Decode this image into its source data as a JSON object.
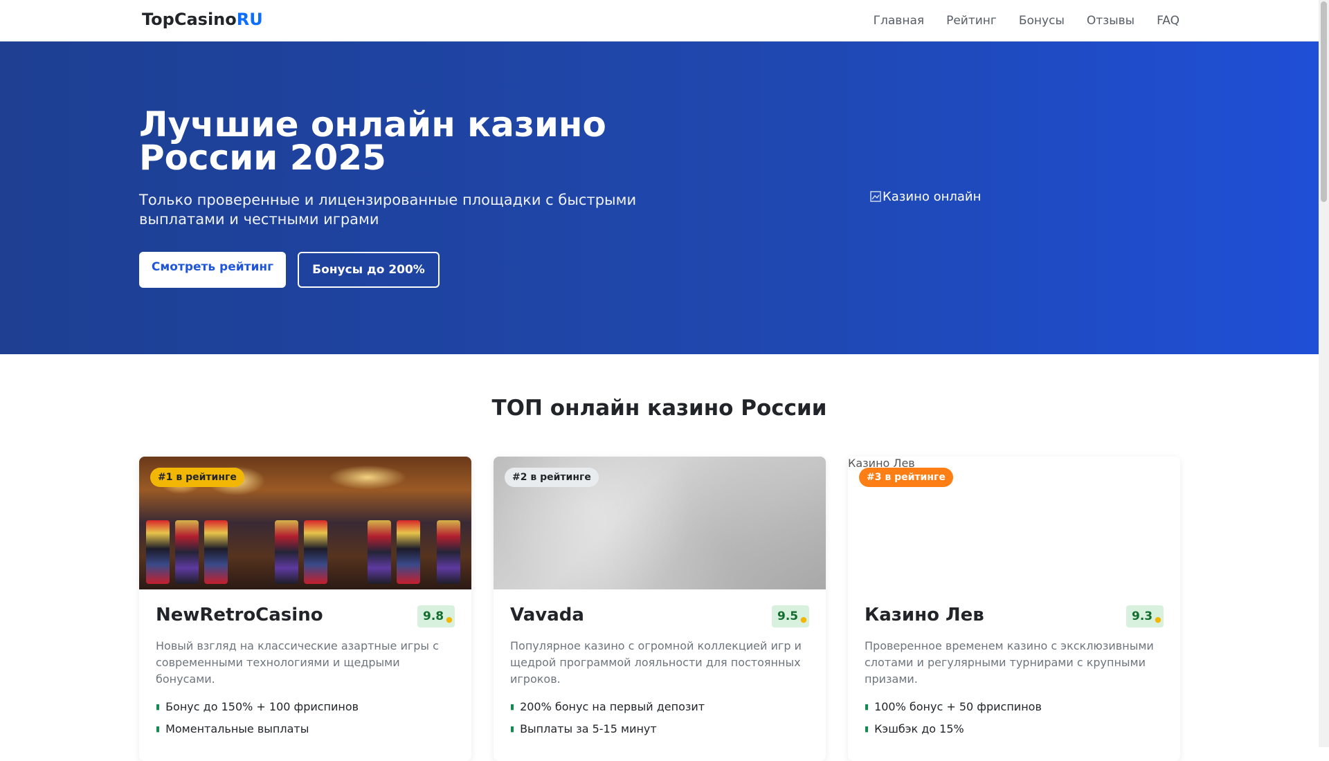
{
  "navbar": {
    "brand_icon": "",
    "brand_main": "TopCasino",
    "brand_accent": "RU",
    "links": [
      "Главная",
      "Рейтинг",
      "Бонусы",
      "Отзывы",
      "FAQ"
    ]
  },
  "hero": {
    "title": "Лучшие онлайн казино России 2025",
    "subtitle": "Только проверенные и лицензированные площадки с быстрыми выплатами и честными играми",
    "primary_button": "Смотреть рейтинг",
    "secondary_button": "Бонусы до 200%",
    "image_alt": "Казино онлайн"
  },
  "section": {
    "title": "ТОП онлайн казино России"
  },
  "cards": [
    {
      "rank": "#1 в рейтинге",
      "name": "NewRetroCasino",
      "rating": "9.8",
      "description": "Новый взгляд на классические азартные игры с современными технологиями и щедрыми бонусами.",
      "features": [
        "Бонус до 150% + 100 фриспинов",
        "Моментальные выплаты"
      ],
      "image": "casino-floor-photo"
    },
    {
      "rank": "#2 в рейтинге",
      "name": "Vavada",
      "rating": "9.5",
      "description": "Популярное казино с огромной коллекцией игр и щедрой программой лояльности для постоянных игроков.",
      "features": [
        "200% бонус на первый депозит",
        "Выплаты за 5-15 минут"
      ],
      "image": "grey-stone-texture"
    },
    {
      "rank": "#3 в рейтинге",
      "name": "Казино Лев",
      "rating": "9.3",
      "description": "Проверенное временем казино с эксклюзивными слотами и регулярными турнирами с крупными призами.",
      "features": [
        "100% бонус + 50 фриспинов",
        "Кэшбэк до 15%"
      ],
      "image_alt": "Казино Лев"
    }
  ],
  "colors": {
    "accent": "#0d6efd",
    "hero_start": "#1e3f92",
    "hero_end": "#1f4fd6",
    "badge_gold": "#f2b705",
    "badge_grey": "#e9ecef",
    "badge_orange": "#fd7e14",
    "rating_bg": "#d8f1de"
  },
  "icons": {
    "brand": "casino-chip-icon",
    "rating": "star-icon",
    "feature": "check-icon"
  }
}
